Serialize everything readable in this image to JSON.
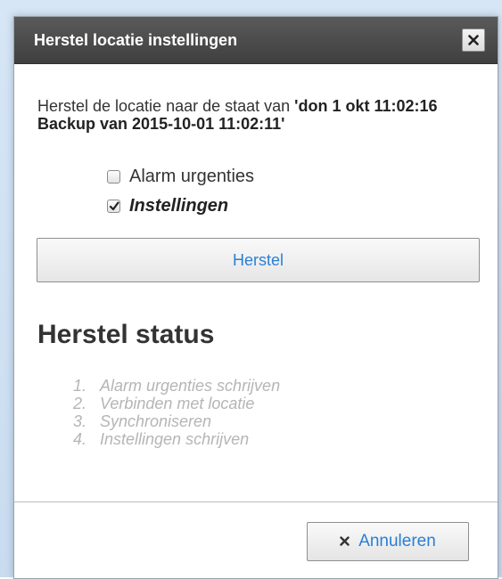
{
  "dialog": {
    "title": "Herstel locatie instellingen",
    "close_icon": "close-icon"
  },
  "description": {
    "prefix": "Herstel de locatie naar de staat van ",
    "snapshot": "'don 1 okt 11:02:16 Backup van 2015-10-01 11:02:11'"
  },
  "options": [
    {
      "label": "Alarm urgenties",
      "checked": false
    },
    {
      "label": "Instellingen",
      "checked": true
    }
  ],
  "restore_button": {
    "label": "Herstel"
  },
  "status": {
    "heading": "Herstel status",
    "steps": [
      {
        "num": "1.",
        "label": "Alarm urgenties schrijven"
      },
      {
        "num": "2.",
        "label": "Verbinden met locatie"
      },
      {
        "num": "3.",
        "label": "Synchroniseren"
      },
      {
        "num": "4.",
        "label": "Instellingen schrijven"
      }
    ]
  },
  "footer": {
    "cancel_label": "Annuleren",
    "cancel_icon": "close-icon"
  },
  "colors": {
    "title_bar": "#474747",
    "link_blue": "#2a7fd4",
    "pending_step": "#b5b5b5"
  }
}
